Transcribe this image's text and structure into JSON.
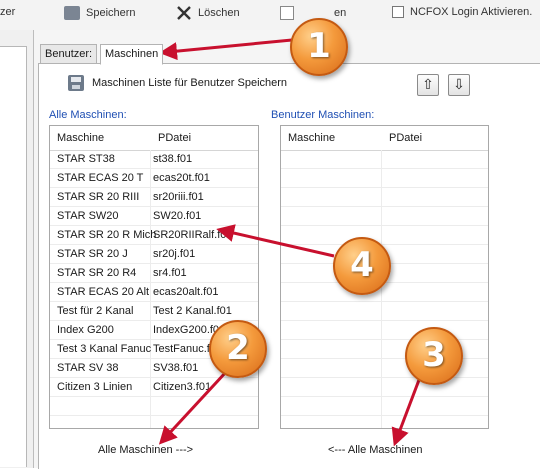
{
  "toolbar": {
    "items": [
      {
        "label": "Speichern"
      },
      {
        "label": "Löschen"
      },
      {
        "label": "en"
      },
      {
        "label": "NCFOX Login Aktivieren."
      }
    ],
    "left_fragment": "zer"
  },
  "tabs": [
    {
      "label": "Benutzer:"
    },
    {
      "label": "Maschinen"
    }
  ],
  "save_list_label": "Maschinen Liste für Benutzer Speichern",
  "all_machines": {
    "title": "Alle Maschinen:",
    "columns": [
      "Maschine",
      "PDatei"
    ],
    "rows": [
      [
        "STAR ST38",
        "st38.f01"
      ],
      [
        "STAR ECAS 20 T",
        "ecas20t.f01"
      ],
      [
        "STAR SR 20 RIII",
        "sr20riii.f01"
      ],
      [
        "STAR SW20",
        "SW20.f01"
      ],
      [
        "STAR SR 20 R Mich",
        "SR20RIIRalf.f01"
      ],
      [
        "STAR SR 20 J",
        "sr20j.f01"
      ],
      [
        "STAR SR 20 R4",
        "sr4.f01"
      ],
      [
        "STAR ECAS 20 Alt",
        "ecas20alt.f01"
      ],
      [
        "Test für 2 Kanal",
        "Test 2 Kanal.f01"
      ],
      [
        "Index G200",
        "IndexG200.f01"
      ],
      [
        "Test 3 Kanal Fanuc",
        "TestFanuc.f01"
      ],
      [
        "STAR SV 38",
        "SV38.f01"
      ],
      [
        "Citizen 3 Linien",
        "Citizen3.f01"
      ]
    ],
    "move_button": "Alle Maschinen --->"
  },
  "user_machines": {
    "title": "Benutzer Maschinen:",
    "columns": [
      "Maschine",
      "PDatei"
    ],
    "rows": [],
    "move_button": "<--- Alle Maschinen"
  },
  "callouts": [
    {
      "number": "1"
    },
    {
      "number": "2"
    },
    {
      "number": "3"
    },
    {
      "number": "4"
    }
  ],
  "icons": {
    "save": "save-icon",
    "up": "arrow-up-icon",
    "down": "arrow-down-icon"
  },
  "colors": {
    "accent_blue": "#1f4fb3",
    "callout_orange": "#f49a3c",
    "arrow_red": "#c8102e"
  }
}
